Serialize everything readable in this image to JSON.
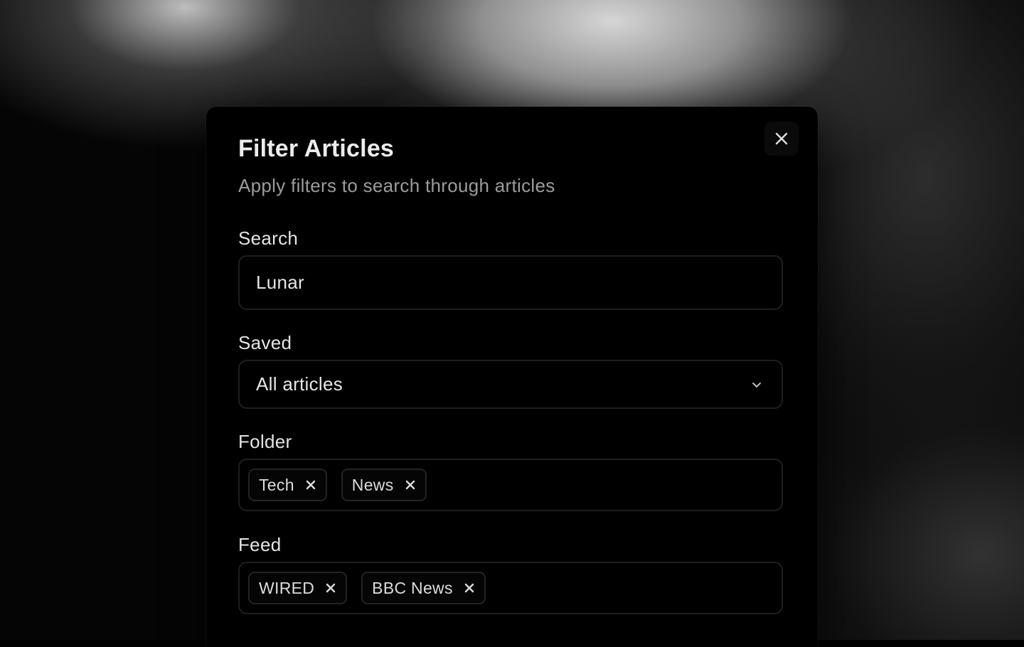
{
  "dialog": {
    "title": "Filter Articles",
    "subtitle": "Apply filters to search through articles",
    "close_icon": "close-icon"
  },
  "search": {
    "label": "Search",
    "value": "Lunar",
    "icon": "none"
  },
  "saved": {
    "label": "Saved",
    "selected": "All articles",
    "icon": "chevron-down-icon"
  },
  "folder": {
    "label": "Folder",
    "chips": [
      {
        "label": "Tech",
        "remove_icon": "remove-icon"
      },
      {
        "label": "News",
        "remove_icon": "remove-icon"
      }
    ]
  },
  "feed": {
    "label": "Feed",
    "chips": [
      {
        "label": "WIRED",
        "remove_icon": "remove-icon"
      },
      {
        "label": "BBC News",
        "remove_icon": "remove-icon"
      }
    ]
  },
  "colors": {
    "background": "#000000",
    "dialog_bg": "#000000",
    "text_primary": "#ececec",
    "text_secondary": "#9c9c9c",
    "border": "#1e1e1e"
  }
}
